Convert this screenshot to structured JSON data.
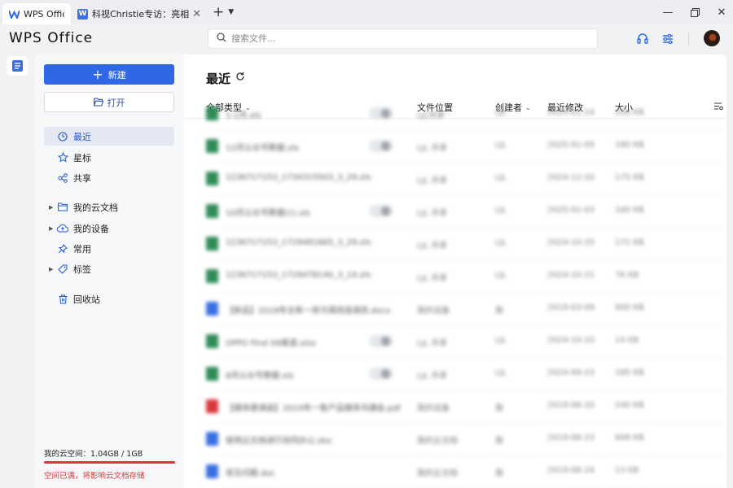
{
  "tabs": [
    {
      "label": "WPS Office",
      "icon": "wps-logo-icon",
      "active": true
    },
    {
      "label": "科视Christie专访：亮相InfoComm Ch",
      "icon": "word-doc-icon",
      "active": false
    }
  ],
  "header": {
    "logo": "WPS Office",
    "search_placeholder": "搜索文件..."
  },
  "sidebar": {
    "new_label": "新建",
    "open_label": "打开",
    "nav": [
      {
        "label": "最近",
        "icon": "clock-icon",
        "selected": true,
        "expandable": false
      },
      {
        "label": "星标",
        "icon": "star-icon",
        "selected": false,
        "expandable": false
      },
      {
        "label": "共享",
        "icon": "share-icon",
        "selected": false,
        "expandable": false
      },
      {
        "label": "我的云文档",
        "icon": "folder-icon",
        "selected": false,
        "expandable": true
      },
      {
        "label": "我的设备",
        "icon": "cloud-upload-icon",
        "selected": false,
        "expandable": true
      },
      {
        "label": "常用",
        "icon": "pin-icon",
        "selected": false,
        "expandable": false
      },
      {
        "label": "标签",
        "icon": "tag-icon",
        "selected": false,
        "expandable": true
      },
      {
        "label": "回收站",
        "icon": "trash-icon",
        "selected": false,
        "expandable": false
      }
    ],
    "storage_label": "我的云空间：1.04GB / 1GB",
    "storage_used_fraction": 1.0,
    "storage_warning": "空间已满，将影响云文档存储"
  },
  "main": {
    "title": "最近",
    "columns": {
      "type": "全部类型",
      "location": "文件位置",
      "creator": "创建者",
      "modified": "最近修改",
      "size": "大小"
    },
    "rows": [
      {
        "type": "xls",
        "name": "1-1月.xls",
        "tag": true,
        "location": "LJL共享",
        "creator": "LJL",
        "modified": "2025-01-14",
        "size": "200 KB"
      },
      {
        "type": "xls",
        "name": "12月公众号数据.xls",
        "tag": true,
        "location": "LJL 共享",
        "creator": "LJL",
        "modified": "2025-01-05",
        "size": "180 KB"
      },
      {
        "type": "xls",
        "name": "1236717153_1734315503_3_29.xls",
        "tag": false,
        "location": "LJL 共享",
        "creator": "LJL",
        "modified": "2024-12-20",
        "size": "175 KB"
      },
      {
        "type": "xls",
        "name": "10月公众号数据(1).xls",
        "tag": true,
        "location": "LJL 共享",
        "creator": "LJL",
        "modified": "2025-01-03",
        "size": "160 KB"
      },
      {
        "type": "xls",
        "name": "1236717153_1729491665_3_29.xls",
        "tag": false,
        "location": "LJL 共享",
        "creator": "LJL",
        "modified": "2024-10-25",
        "size": "172 KB"
      },
      {
        "type": "xls",
        "name": "1236717153_1729478140_3_14.xls",
        "tag": false,
        "location": "LJL 共享",
        "creator": "LJL",
        "modified": "2024-10-21",
        "size": "76 KB"
      },
      {
        "type": "doc",
        "name": "【新品】2018年全新一体污调改造调改.docx",
        "tag": false,
        "location": "我的设备",
        "creator": "我",
        "modified": "2019-03-09",
        "size": "900 KB"
      },
      {
        "type": "xls",
        "name": "OPPO Find X8渠道.xlsx",
        "tag": true,
        "location": "LJL 共享",
        "creator": "LJL",
        "modified": "2024-10-10",
        "size": "14 KB"
      },
      {
        "type": "xls",
        "name": "8月公众号数据.xls",
        "tag": true,
        "location": "LJL 共享",
        "creator": "LJL",
        "modified": "2024-09-23",
        "size": "185 KB"
      },
      {
        "type": "pdf",
        "name": "【媒体邀请函】2019年一售产品媒体沟通会.pdf",
        "tag": false,
        "location": "我的设备",
        "creator": "我",
        "modified": "2019-06-20",
        "size": "240 KB"
      },
      {
        "type": "doc",
        "name": "使用云文档进行协同办公.doc",
        "tag": false,
        "location": "我的云文档",
        "creator": "我",
        "modified": "2019-06-23",
        "size": "608 KB"
      },
      {
        "type": "doc",
        "name": "常见问题.doc",
        "tag": false,
        "location": "我的云文档",
        "creator": "我",
        "modified": "2019-06-24",
        "size": "13 KB"
      }
    ]
  },
  "colors": {
    "accent": "#2f68e6",
    "danger": "#d8383c",
    "xls": "#2e8b57",
    "doc": "#3a6fe0",
    "pdf": "#d8383c"
  }
}
